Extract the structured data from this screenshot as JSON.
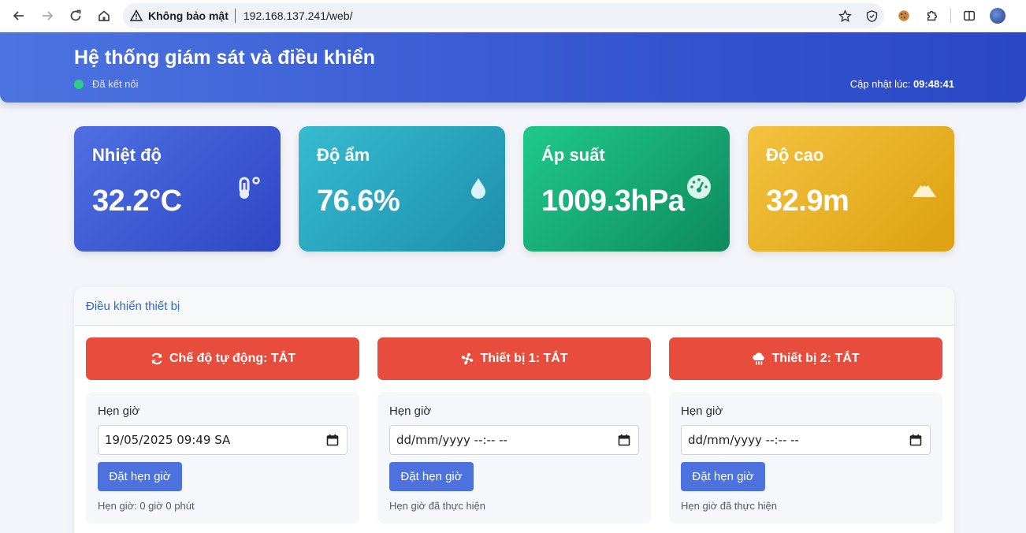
{
  "browser": {
    "security_label": "Không bảo mật",
    "url": "192.168.137.241/web/",
    "icons": [
      "back-icon",
      "forward-icon",
      "reload-icon",
      "home-icon",
      "warning-icon",
      "star-icon",
      "shield-icon",
      "cookie-icon",
      "puzzle-icon",
      "sidepanel-icon",
      "avatar"
    ]
  },
  "header": {
    "title": "Hệ thống giám sát và điều khiển",
    "connection_status": "Đã kết nối",
    "updated_label": "Cập nhật lúc:",
    "updated_time": "09:48:41"
  },
  "sensors": [
    {
      "label": "Nhiệt độ",
      "value": "32.2°C",
      "icon": "thermometer-icon",
      "color": "#3a57d0"
    },
    {
      "label": "Độ ẩm",
      "value": "76.6%",
      "icon": "droplet-icon",
      "color": "#27a6c0"
    },
    {
      "label": "Áp suất",
      "value": "1009.3hPa",
      "icon": "gauge-icon",
      "color": "#16a874"
    },
    {
      "label": "Độ cao",
      "value": "32.9m",
      "icon": "mountain-icon",
      "color": "#e8b025"
    }
  ],
  "control": {
    "title": "Điều khiển thiết bị",
    "buttons": [
      {
        "label": "Chế độ tự động: TẮT",
        "icon": "sync-icon"
      },
      {
        "label": "Thiết bị 1: TẮT",
        "icon": "fan-icon"
      },
      {
        "label": "Thiết bị 2: TẮT",
        "icon": "cloud-rain-icon"
      }
    ],
    "schedules": [
      {
        "label": "Hẹn giờ",
        "value": "19/05/2025 09:49  SA",
        "button": "Đặt hẹn giờ",
        "status": "Hẹn giờ: 0 giờ 0 phút"
      },
      {
        "label": "Hẹn giờ",
        "value": "dd/mm/yyyy --:-- --",
        "button": "Đặt hẹn giờ",
        "status": "Hẹn giờ đã thực hiện"
      },
      {
        "label": "Hẹn giờ",
        "value": "dd/mm/yyyy --:-- --",
        "button": "Đặt hẹn giờ",
        "status": "Hẹn giờ đã thực hiện"
      }
    ]
  },
  "colors": {
    "header": "#3556d0",
    "off_button": "#e74c3c",
    "schedule_button": "#4d72de",
    "connected_dot": "#2ecc8a",
    "link": "#2f66d6"
  }
}
